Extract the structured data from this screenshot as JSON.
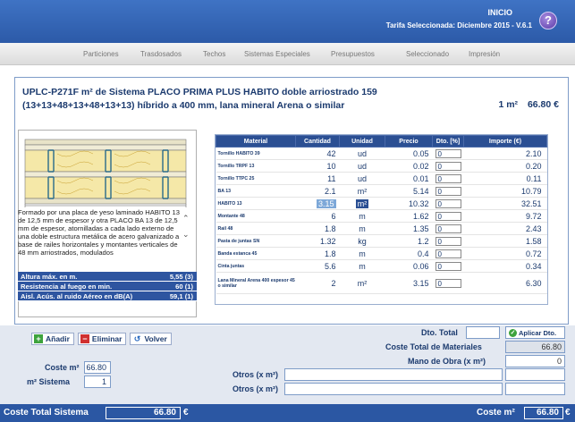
{
  "header": {
    "home_label": "INICIO",
    "tarifa_label": "Tarifa Seleccionada: Diciembre 2015 - V.6.1",
    "help_icon": "?"
  },
  "menu": {
    "items": [
      "Particiones",
      "Trasdosados",
      "Techos",
      "Sistemas Especiales",
      "Presupuestos",
      "Seleccionado",
      "Impresión"
    ]
  },
  "system": {
    "title": "UPLC-P271F m² de Sistema PLACO PRIMA PLUS HABITO doble arriostrado 159 (13+13+48+13+48+13+13) híbrido a 400 mm, lana mineral Arena o similar",
    "unit_label": "1 m²",
    "unit_price": "66.80 €",
    "description": "Formado por una placa de yeso laminado HABITO 13 de 12,5 mm de espesor y otra PLACO BA 13 de 12,5 mm de espesor, atornilladas a cada lado externo de una doble estructura metálica de acero galvanizado a base de railes horizontales y montantes verticales de 48 mm arriostrados, modulados",
    "properties": [
      {
        "label": "Altura máx. en m.",
        "value": "5,55 (3)"
      },
      {
        "label": "Resistencia al fuego en min.",
        "value": "60 (1)"
      },
      {
        "label": "Aisl. Acús. al ruido Aéreo en dB(A)",
        "value": "59,1 (1)"
      }
    ]
  },
  "table": {
    "headers": [
      "Material",
      "Cantidad",
      "Unidad",
      "Precio",
      "Dto. [%]",
      "Importe (€)"
    ],
    "rows": [
      {
        "material": "Tornillo HABITO 39",
        "cantidad": "42",
        "unidad": "ud",
        "precio": "0.05",
        "dto": "0",
        "importe": "2.10"
      },
      {
        "material": "Tornillo TRPF 13",
        "cantidad": "10",
        "unidad": "ud",
        "precio": "0.02",
        "dto": "0",
        "importe": "0.20"
      },
      {
        "material": "Tornillo TTPC 25",
        "cantidad": "11",
        "unidad": "ud",
        "precio": "0.01",
        "dto": "0",
        "importe": "0.11"
      },
      {
        "material": "BA 13",
        "cantidad": "2.1",
        "unidad": "m²",
        "precio": "5.14",
        "dto": "0",
        "importe": "10.79"
      },
      {
        "material": "HABITO 13",
        "cantidad": "3.15",
        "unidad": "m²",
        "precio": "10.32",
        "dto": "0",
        "importe": "32.51"
      },
      {
        "material": "Montante 48",
        "cantidad": "6",
        "unidad": "m",
        "precio": "1.62",
        "dto": "0",
        "importe": "9.72"
      },
      {
        "material": "Rail 48",
        "cantidad": "1.8",
        "unidad": "m",
        "precio": "1.35",
        "dto": "0",
        "importe": "2.43"
      },
      {
        "material": "Pasta de juntas SN",
        "cantidad": "1.32",
        "unidad": "kg",
        "precio": "1.2",
        "dto": "0",
        "importe": "1.58"
      },
      {
        "material": "Banda estanca 45",
        "cantidad": "1.8",
        "unidad": "m",
        "precio": "0.4",
        "dto": "0",
        "importe": "0.72"
      },
      {
        "material": "Cinta juntas",
        "cantidad": "5.6",
        "unidad": "m",
        "precio": "0.06",
        "dto": "0",
        "importe": "0.34"
      },
      {
        "material": "Lana Mineral Arena 400 espesor 45 o similar",
        "cantidad": "2",
        "unidad": "m²",
        "precio": "3.15",
        "dto": "0",
        "importe": "6.30"
      }
    ]
  },
  "actions": {
    "add_label": "Añadir",
    "delete_label": "Eliminar",
    "back_label": "Volver"
  },
  "costs": {
    "coste_m2_label": "Coste m²",
    "coste_m2_value": "66.80",
    "m2_sistema_label": "m² Sistema",
    "m2_sistema_value": "1",
    "dto_total_label": "Dto. Total",
    "dto_total_value": "",
    "aplicar_label": "Aplicar Dto.",
    "coste_total_materiales_label": "Coste Total de Materiales",
    "coste_total_materiales_value": "66.80",
    "mano_obra_label": "Mano de Obra (x m²)",
    "mano_obra_value": "0",
    "otros1_label": "Otros (x m²)",
    "otros2_label": "Otros (x m²)"
  },
  "footer": {
    "coste_total_sistema_label": "Coste Total Sistema",
    "coste_total_sistema_value": "66.80",
    "euro": "€",
    "coste_m2_label": "Coste m²",
    "coste_m2_value": "66.80",
    "euro2": "€"
  },
  "colors": {
    "header_blue": "#2c5aa8",
    "table_header": "#2b4f93",
    "footer_blue": "#2b57a3"
  }
}
